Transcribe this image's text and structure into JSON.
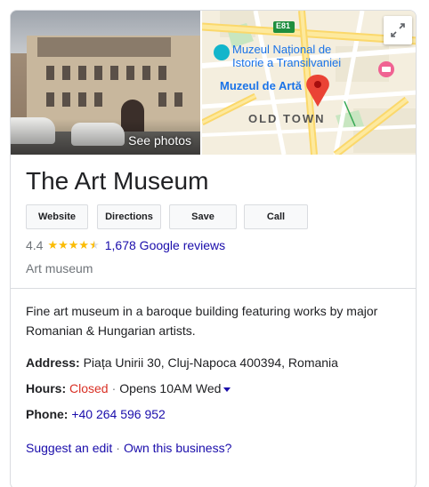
{
  "hero": {
    "photo_caption": "See photos",
    "map": {
      "route_badge": "E81",
      "museum_label_line1": "Muzeul Național de",
      "museum_label_line2": "Istorie a Transilvaniei",
      "pin_label": "Muzeul de Artă",
      "district_label": "OLD TOWN"
    }
  },
  "business": {
    "name": "The Art Museum",
    "actions": [
      "Website",
      "Directions",
      "Save",
      "Call"
    ],
    "rating": "4.4",
    "stars_filled": 4.5,
    "reviews_link": "1,678 Google reviews",
    "category": "Art museum"
  },
  "details": {
    "description": "Fine art museum in a baroque building featuring works by major Romanian & Hungarian artists.",
    "address_label": "Address:",
    "address_value": "Piața Unirii 30, Cluj-Napoca 400394, Romania",
    "hours_label": "Hours:",
    "hours_status": "Closed",
    "hours_next": "Opens 10AM Wed",
    "phone_label": "Phone:",
    "phone_value": "+40 264 596 952"
  },
  "footer": {
    "suggest_edit": "Suggest an edit",
    "own_business": "Own this business?"
  },
  "colors": {
    "link": "#1a0dab",
    "closed": "#d93025",
    "star": "#fbbc04",
    "map_pin": "#ea4335"
  }
}
